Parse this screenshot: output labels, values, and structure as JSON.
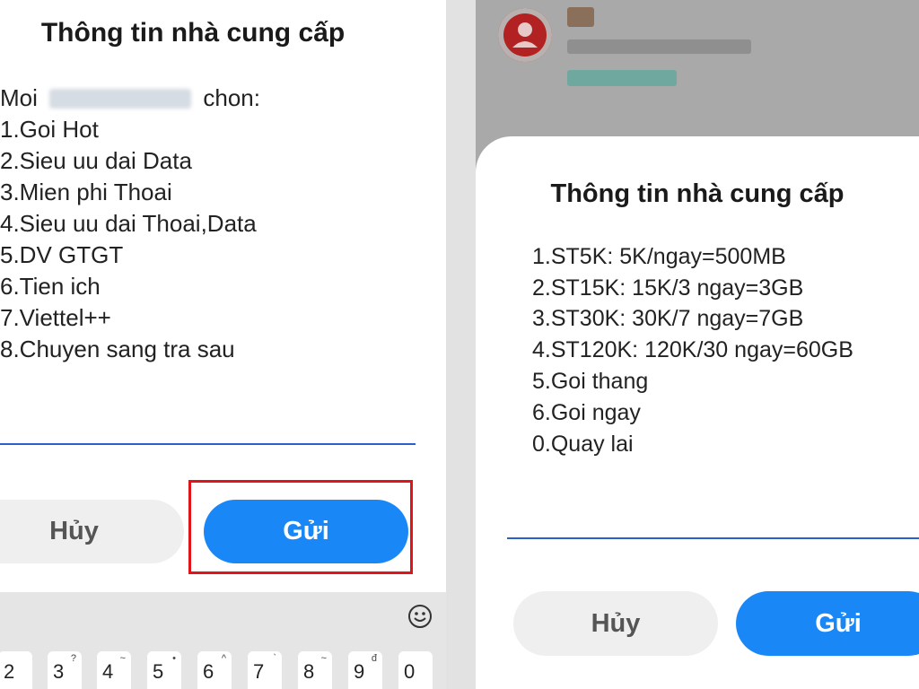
{
  "left_dialog": {
    "title": "Thông tin nhà cung cấp",
    "intro_prefix": "Moi",
    "intro_suffix": "chon:",
    "items": [
      "1.Goi Hot",
      "2.Sieu uu dai Data",
      "3.Mien phi Thoai",
      "4.Sieu uu dai Thoai,Data",
      "5.DV GTGT",
      "6.Tien ich",
      "7.Viettel++",
      "8.Chuyen sang tra sau"
    ],
    "cancel_label": "Hủy",
    "send_label": "Gửi"
  },
  "keyboard": {
    "emoji_icon": "smiley-icon",
    "keys": [
      {
        "main": "2",
        "alt": ""
      },
      {
        "main": "3",
        "alt": "?"
      },
      {
        "main": "4",
        "alt": "~"
      },
      {
        "main": "5",
        "alt": "•"
      },
      {
        "main": "6",
        "alt": "^"
      },
      {
        "main": "7",
        "alt": "`"
      },
      {
        "main": "8",
        "alt": "~"
      },
      {
        "main": "9",
        "alt": "đ"
      },
      {
        "main": "0",
        "alt": ""
      }
    ]
  },
  "right_dialog": {
    "title": "Thông tin nhà cung cấp",
    "items": [
      "1.ST5K: 5K/ngay=500MB",
      "2.ST15K: 15K/3 ngay=3GB",
      "3.ST30K: 30K/7 ngay=7GB",
      "4.ST120K: 120K/30 ngay=60GB",
      "5.Goi thang",
      "6.Goi ngay",
      "0.Quay lai"
    ],
    "cancel_label": "Hủy",
    "send_label": "Gửi"
  },
  "colors": {
    "send_button": "#1a87f7",
    "cancel_button": "#efefef",
    "highlight": "#e0141b",
    "input_underline": "#2b5fcc"
  }
}
